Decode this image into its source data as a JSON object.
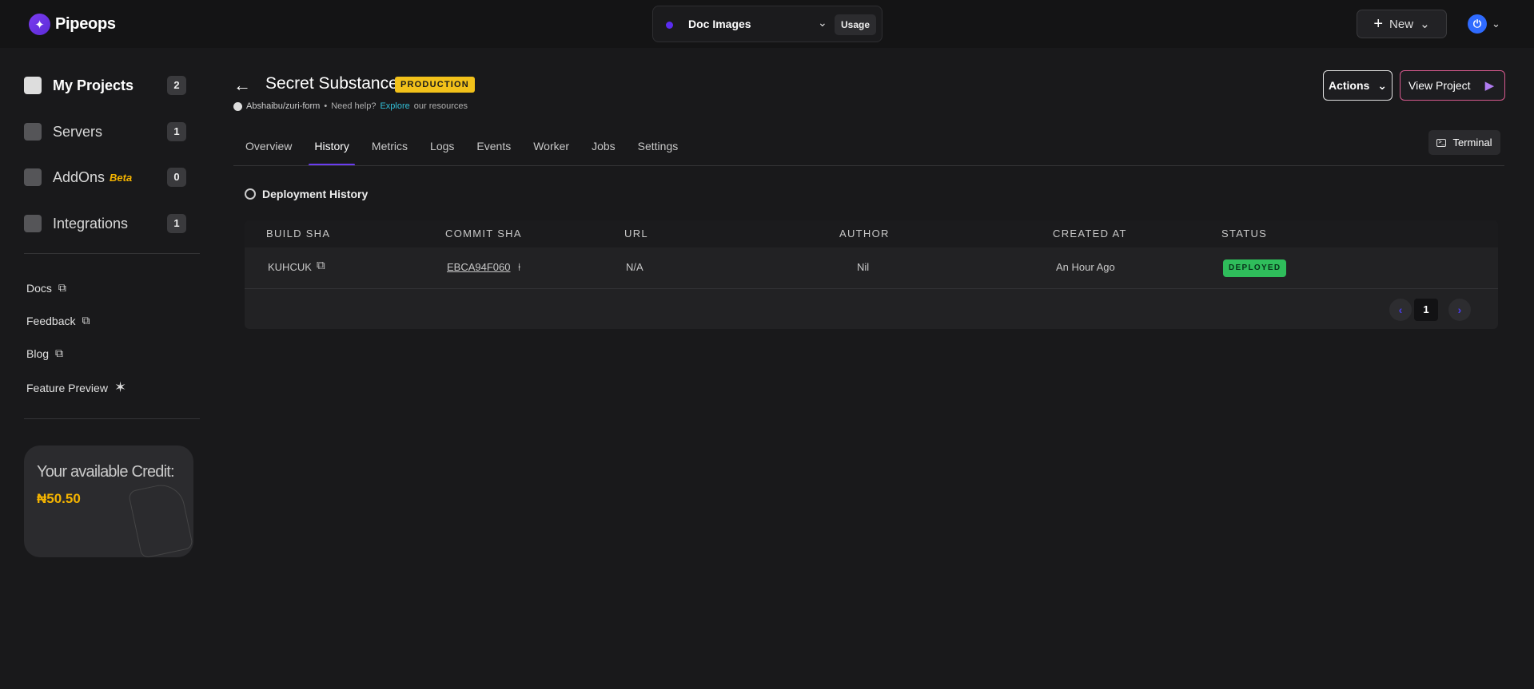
{
  "brand": {
    "name": "Pipeops"
  },
  "topbar": {
    "project_name": "Doc Images",
    "usage_label": "Usage",
    "new_label": "New"
  },
  "sidebar": {
    "items": [
      {
        "label": "My Projects",
        "count": "2",
        "icon": "file-icon"
      },
      {
        "label": "Servers",
        "count": "1",
        "icon": "server-icon"
      },
      {
        "label": "AddOns",
        "badge": "Beta",
        "count": "0",
        "icon": "plug-icon"
      },
      {
        "label": "Integrations",
        "count": "1",
        "icon": "puzzle-icon"
      }
    ],
    "links": [
      {
        "label": "Docs",
        "icon": "external-link-icon"
      },
      {
        "label": "Feedback",
        "icon": "external-link-icon"
      },
      {
        "label": "Blog",
        "icon": "external-link-icon"
      },
      {
        "label": "Feature Preview",
        "icon": "sparkle-icon"
      }
    ],
    "credit": {
      "title": "Your available Credit:",
      "amount": "₦50.50"
    }
  },
  "project": {
    "title": "Secret Substance",
    "env_badge": "PRODUCTION",
    "repo": "Abshaibu/zuri-form",
    "help_prefix": "Need help?",
    "help_link": "Explore",
    "help_suffix": "our resources"
  },
  "header_actions": {
    "actions_label": "Actions",
    "view_label": "View Project",
    "terminal_label": "Terminal"
  },
  "tabs": [
    "Overview",
    "History",
    "Metrics",
    "Logs",
    "Events",
    "Worker",
    "Jobs",
    "Settings"
  ],
  "active_tab": "History",
  "history": {
    "title": "Deployment History",
    "columns": [
      "BUILD SHA",
      "COMMIT SHA",
      "URL",
      "AUTHOR",
      "CREATED AT",
      "STATUS"
    ],
    "rows": [
      {
        "build_sha": "KUHCUK",
        "commit_sha": "EBCA94F060",
        "url": "N/A",
        "author": "Nil",
        "created_at": "An Hour Ago",
        "status": "DEPLOYED"
      }
    ],
    "pagination": {
      "current_page": "1"
    }
  },
  "colors": {
    "accent": "#6a3cf0",
    "badge_yellow": "#f2c11a",
    "status_green": "#2fbd5b",
    "credit_gold": "#f5b400"
  }
}
